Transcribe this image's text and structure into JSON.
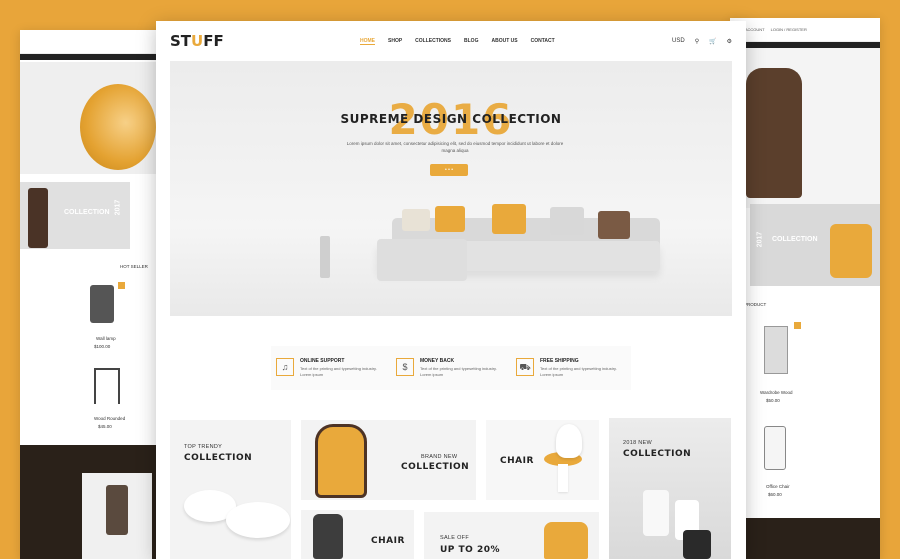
{
  "colors": {
    "accent": "#e9a93b",
    "dark": "#222222"
  },
  "main": {
    "logo": {
      "part1": "ST",
      "part2": "U",
      "part3": "FF"
    },
    "nav": [
      "HOME",
      "SHOP",
      "COLLECTIONS",
      "BLOG",
      "ABOUT US",
      "CONTACT"
    ],
    "currency": "USD",
    "icons": [
      "search-icon",
      "cart-icon",
      "gear-icon"
    ],
    "hero": {
      "year": "2016",
      "title": "SUPREME DESIGN COLLECTION",
      "desc": "Lorem ipsum dolor sit amet, consectetur adipisicing elit, sed do eiusmod tempor incididunt ut labore et dolore magna aliqua"
    },
    "features": [
      {
        "title": "ONLINE SUPPORT",
        "desc": "Text of the printing and typesetting industry. Lorem ipsum",
        "icon": "headphones-icon"
      },
      {
        "title": "MONEY BACK",
        "desc": "Text of the printing and typesetting industry. Lorem ipsum",
        "icon": "dollar-icon"
      },
      {
        "title": "FREE SHIPPING",
        "desc": "Text of the printing and typesetting industry. Lorem ipsum",
        "icon": "truck-icon"
      }
    ],
    "tiles": {
      "top_trendy_small": "TOP TRENDY",
      "top_trendy_big": "COLLECTION",
      "brand_new_small": "BRAND NEW",
      "brand_new_big": "COLLECTION",
      "chair1": "CHAIR",
      "new2018_small": "2018 NEW",
      "new2018_big": "COLLECTION",
      "chair2": "CHAIR",
      "saleoff_small": "SALE OFF",
      "saleoff_big": "UP TO 20%"
    }
  },
  "left_panel": {
    "banner_big": "COLLECTION",
    "banner_year": "2017",
    "section": "HOT SELLER",
    "products": [
      {
        "name": "Wall lamp",
        "price": "$100.00"
      },
      {
        "name": "Wood Rounded",
        "price": "$45.00"
      }
    ]
  },
  "right_panel": {
    "nav": [
      "MY ACCOUNT",
      "LOGIN / REGISTER"
    ],
    "banner_big": "COLLECTION",
    "banner_year": "2017",
    "section": "PRODUCT",
    "products": [
      {
        "name": "Wardrobe Wood",
        "price": "$50.00"
      },
      {
        "name": "Office Chair",
        "price": "$60.00"
      }
    ]
  }
}
